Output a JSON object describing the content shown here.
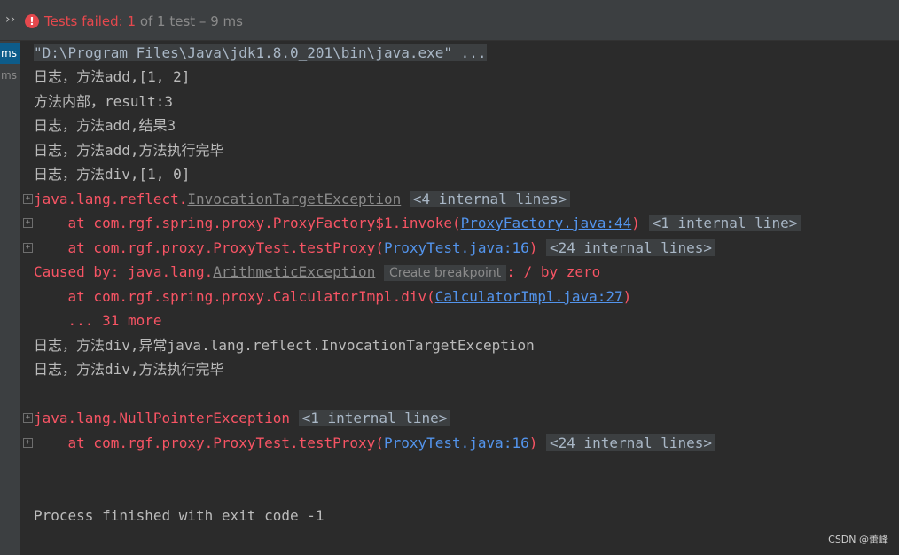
{
  "header": {
    "status_failed": "Tests failed: 1",
    "status_rest": " of 1 test – 9 ms",
    "chevron": "››",
    "error_icon": "!"
  },
  "left_pane": {
    "items": [
      {
        "label": "ms",
        "selected": true
      },
      {
        "label": "ms",
        "selected": false
      }
    ]
  },
  "console": {
    "command": "\"D:\\Program Files\\Java\\jdk1.8.0_201\\bin\\java.exe\" ...",
    "log1": "日志，方法add,[1, 2]",
    "log2": "方法内部，result:3",
    "log3": "日志，方法add,结果3",
    "log4": "日志，方法add,方法执行完毕",
    "log5": "日志，方法div,[1, 0]",
    "ex1_prefix": "java.lang.reflect.",
    "ex1_name": "InvocationTargetException",
    "ex1_internal": "<4 internal lines>",
    "at1_prefix": "    at com.rgf.spring.proxy.ProxyFactory$1.invoke(",
    "at1_link": "ProxyFactory.java:44",
    "at1_suffix": ")",
    "at1_internal": "<1 internal line>",
    "at2_prefix": "    at com.rgf.proxy.ProxyTest.testProxy(",
    "at2_link": "ProxyTest.java:16",
    "at2_suffix": ")",
    "at2_internal": "<24 internal lines>",
    "caused_prefix": "Caused by: java.lang.",
    "caused_name": "ArithmeticException",
    "caused_tooltip": "Create breakpoint",
    "caused_suffix": ": / by zero",
    "at3_prefix": "    at com.rgf.spring.proxy.CalculatorImpl.div(",
    "at3_link": "CalculatorImpl.java:27",
    "at3_suffix": ")",
    "more": "    ... 31 more",
    "log6": "日志，方法div,异常java.lang.reflect.InvocationTargetException",
    "log7": "日志，方法div,方法执行完毕",
    "ex2_name": "java.lang.NullPointerException",
    "ex2_internal": "<1 internal line>",
    "at4_prefix": "    at com.rgf.proxy.ProxyTest.testProxy(",
    "at4_link": "ProxyTest.java:16",
    "at4_suffix": ")",
    "at4_internal": "<24 internal lines>",
    "finished": "Process finished with exit code -1"
  },
  "watermark": "CSDN @蕾峰"
}
